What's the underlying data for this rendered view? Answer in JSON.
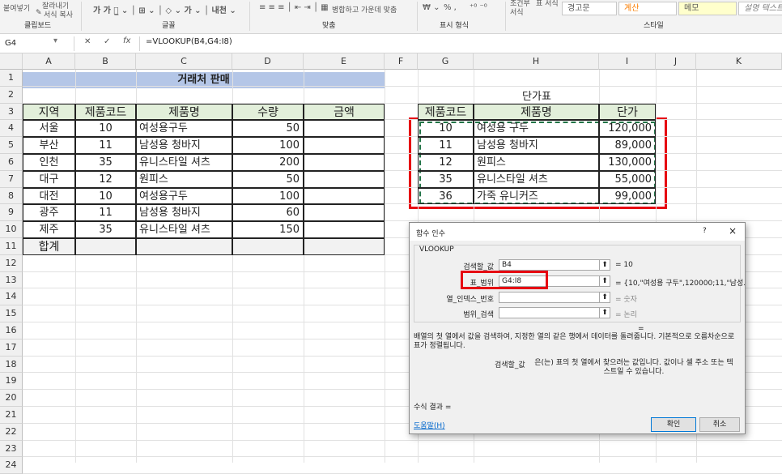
{
  "ribbon": {
    "paste_label": "붙여넣기",
    "cut_label": "잘라내기",
    "format_painter": "서식 복사",
    "groups": [
      "클립보드",
      "글꼴",
      "맞춤",
      "표시 형식",
      "스타일"
    ],
    "merge_center": "병합하고 가운데 맞춤",
    "number_tools": "% ,",
    "conditional": "조건부 서식",
    "table_format": "표 서식",
    "styles": [
      "경고문",
      "계산",
      "메모",
      "설명 텍스트"
    ]
  },
  "formula_bar": {
    "name_box": "G4",
    "formula": "=VLOOKUP(B4,G4:I8)"
  },
  "columns": [
    "A",
    "B",
    "C",
    "D",
    "E",
    "F",
    "G",
    "H",
    "I",
    "J",
    "K"
  ],
  "rows": [
    "1",
    "2",
    "3",
    "4",
    "5",
    "6",
    "7",
    "8",
    "9",
    "10",
    "11",
    "12",
    "13",
    "14",
    "15",
    "16",
    "17",
    "18",
    "19",
    "20",
    "21",
    "22",
    "23",
    "24"
  ],
  "sales": {
    "title": "거래처 판매",
    "headers": [
      "지역",
      "제품코드",
      "제품명",
      "수량",
      "금액"
    ],
    "rows": [
      [
        "서울",
        "10",
        "여성용구두",
        "50"
      ],
      [
        "부산",
        "11",
        "남성용 청바지",
        "100"
      ],
      [
        "인천",
        "35",
        "유니스타일 셔츠",
        "200"
      ],
      [
        "대구",
        "12",
        "원피스",
        "50"
      ],
      [
        "대전",
        "10",
        "여성용구두",
        "100"
      ],
      [
        "광주",
        "11",
        "남성용 청바지",
        "60"
      ],
      [
        "제주",
        "35",
        "유니스타일 셔츠",
        "150"
      ]
    ],
    "total_label": "합계"
  },
  "price": {
    "title": "단가표",
    "headers": [
      "제품코드",
      "제품명",
      "단가"
    ],
    "rows": [
      [
        "10",
        "여성용 구두",
        "120,000"
      ],
      [
        "11",
        "남성용 청바지",
        "89,000"
      ],
      [
        "12",
        "원피스",
        "130,000"
      ],
      [
        "35",
        "유니스타일 셔츠",
        "55,000"
      ],
      [
        "36",
        "가죽 유니커즈",
        "99,000"
      ]
    ]
  },
  "dialog": {
    "title": "함수 인수",
    "help_q": "?",
    "close": "×",
    "fn": "VLOOKUP",
    "args": [
      {
        "label": "검색할_값",
        "value": "B4",
        "result": "= 10"
      },
      {
        "label": "표_범위",
        "value": "G4:I8",
        "result": "= {10,\"여성용 구두\",120000;11,\"남성..."
      },
      {
        "label": "열_인덱스_번호",
        "value": "",
        "result": "= 숫자"
      },
      {
        "label": "범위_검색",
        "value": "",
        "result": "= 논리"
      }
    ],
    "eq": "=",
    "description": "배열의 첫 열에서 값을 검색하여, 지정한 열의 같은 행에서 데이터를 돌려줍니다. 기본적으로 오름차순으로 표가 정렬됩니다.",
    "arg_label": "검색할_값",
    "arg_help": "은(는) 표의 첫 열에서 찾으려는 값입니다. 값이나 셀 주소 또는 텍스트일 수 있습니다.",
    "formula_result": "수식 결과 =",
    "help_link": "도움말(H)",
    "ok": "확인",
    "cancel": "취소"
  },
  "colors": {
    "title_fill": "#b4c6e7",
    "header_fill": "#e2efda",
    "total_fill": "#f2f2f2",
    "highlight": "#e60012",
    "marquee": "#217346"
  }
}
